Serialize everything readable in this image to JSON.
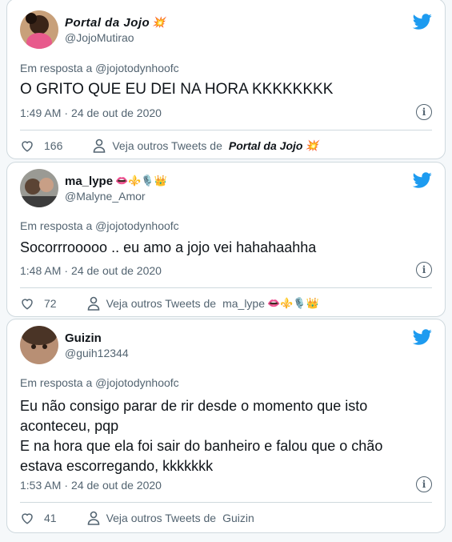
{
  "tweets": [
    {
      "display_name": "Portal da Jojo",
      "name_emoji": "💥",
      "handle": "@JojoMutirao",
      "reply_to": "Em resposta a @jojotodynhoofc",
      "text": "O GRITO QUE EU DEI NA HORA KKKKKKKK",
      "time": "1:49 AM",
      "date": "24 de out de 2020",
      "likes": "166",
      "more_prefix": "Veja outros Tweets de",
      "more_name": "Portal da Jojo",
      "more_emoji": "💥"
    },
    {
      "display_name": "ma_lype",
      "name_emoji": "👄⚜️🎙️👑",
      "handle": "@Malyne_Amor",
      "reply_to": "Em resposta a @jojotodynhoofc",
      "text": "Socorrrooooo .. eu amo a jojo vei hahahaahha",
      "time": "1:48 AM",
      "date": "24 de out de 2020",
      "likes": "72",
      "more_prefix": "Veja outros Tweets de",
      "more_name": "ma_lype",
      "more_emoji": "👄⚜️🎙️👑"
    },
    {
      "display_name": "Guizin",
      "name_emoji": "",
      "handle": "@guih12344",
      "reply_to": "Em resposta a @jojotodynhoofc",
      "text": "Eu não consigo parar de rir desde o momento que isto aconteceu, pqp\nE na hora que ela foi sair do banheiro e falou que o chão estava escorregando, kkkkkkk",
      "time": "1:53 AM",
      "date": "24 de out de 2020",
      "likes": "41",
      "more_prefix": "Veja outros Tweets de",
      "more_name": "Guizin",
      "more_emoji": ""
    }
  ],
  "separator": "·",
  "colors": {
    "twitter_blue": "#1d9bf0",
    "secondary_text": "#536471",
    "border": "#cfd9de"
  }
}
